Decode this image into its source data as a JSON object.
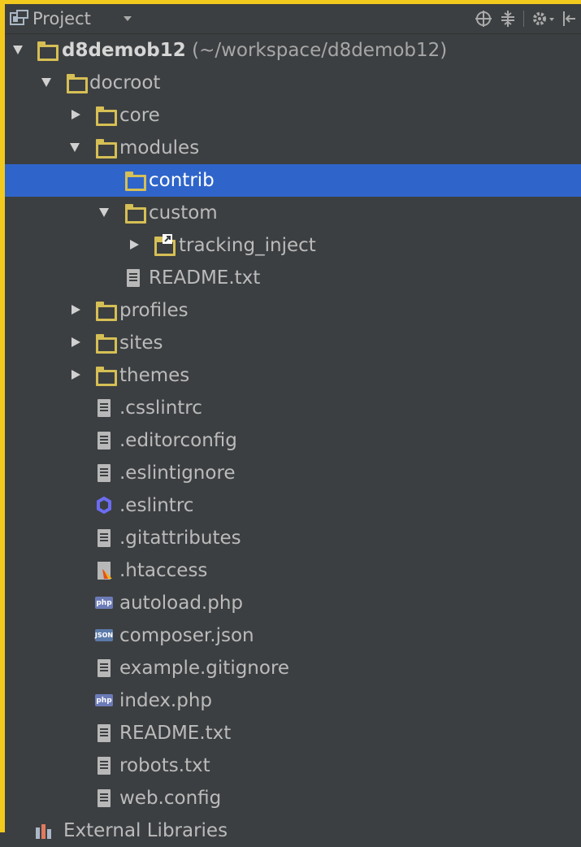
{
  "header": {
    "title": "Project",
    "icons": [
      "project-view-icon",
      "dropdown-arrow-icon",
      "locate-icon",
      "collapse-all-icon",
      "settings-icon",
      "hide-icon"
    ]
  },
  "tree": {
    "root": {
      "name": "d8demob12",
      "path": "(~/workspace/d8demob12)"
    },
    "docroot": "docroot",
    "core": "core",
    "modules": "modules",
    "contrib": "contrib",
    "custom": "custom",
    "tracking_inject": "tracking_inject",
    "modules_readme": "README.txt",
    "profiles": "profiles",
    "sites": "sites",
    "themes": "themes",
    "files": [
      {
        "name": ".csslintrc",
        "icon": "text-file-icon"
      },
      {
        "name": ".editorconfig",
        "icon": "text-file-icon"
      },
      {
        "name": ".eslintignore",
        "icon": "text-file-icon"
      },
      {
        "name": ".eslintrc",
        "icon": "eslint-config-icon"
      },
      {
        "name": ".gitattributes",
        "icon": "text-file-icon"
      },
      {
        "name": ".htaccess",
        "icon": "htaccess-file-icon"
      },
      {
        "name": "autoload.php",
        "icon": "php-file-icon"
      },
      {
        "name": "composer.json",
        "icon": "json-file-icon"
      },
      {
        "name": "example.gitignore",
        "icon": "text-file-icon"
      },
      {
        "name": "index.php",
        "icon": "php-file-icon"
      },
      {
        "name": "README.txt",
        "icon": "text-file-icon"
      },
      {
        "name": "robots.txt",
        "icon": "text-file-icon"
      },
      {
        "name": "web.config",
        "icon": "text-file-icon"
      }
    ],
    "external_libraries": "External Libraries"
  },
  "colors": {
    "background": "#3c3f41",
    "selection": "#2f65ca",
    "folder": "#d6bf55",
    "focus_border": "#f2ca1e"
  }
}
